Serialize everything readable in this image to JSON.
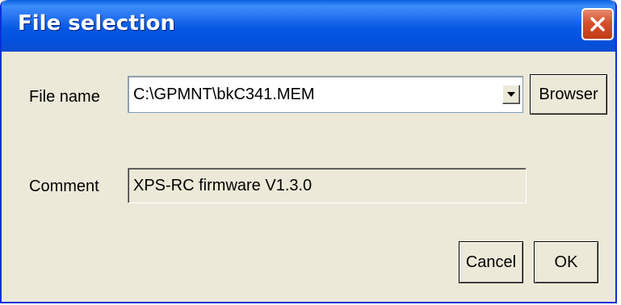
{
  "window": {
    "title": "File selection"
  },
  "file_name": {
    "label": "File name",
    "value": "C:\\GPMNT\\bkC341.MEM",
    "browse_label": "Browser"
  },
  "comment": {
    "label": "Comment",
    "value": "XPS-RC firmware V1.3.0"
  },
  "actions": {
    "cancel_label": "Cancel",
    "ok_label": "OK"
  },
  "icons": {
    "close": "close-icon",
    "dropdown": "chevron-down-icon"
  },
  "colors": {
    "titlebar": "#0558e3",
    "close_button": "#d5502b",
    "dialog_background": "#ece9d8"
  }
}
